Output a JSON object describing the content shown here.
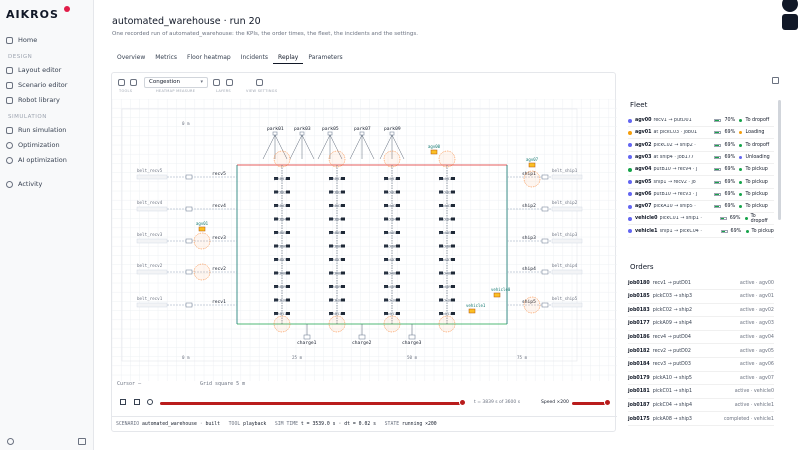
{
  "app": {
    "logo": "AIKROS"
  },
  "sidebar": {
    "items": [
      {
        "label": "Home",
        "icon": "home-icon"
      },
      {
        "section": "DESIGN"
      },
      {
        "label": "Layout editor",
        "icon": "layout-icon"
      },
      {
        "label": "Scenario editor",
        "icon": "scenario-icon"
      },
      {
        "label": "Robot library",
        "icon": "robot-icon"
      },
      {
        "section": "SIMULATION"
      },
      {
        "label": "Run simulation",
        "icon": "play-icon"
      },
      {
        "label": "Optimization",
        "icon": "optimization-icon"
      },
      {
        "label": "AI optimization",
        "icon": "ai-icon"
      },
      {
        "label": "Activity",
        "icon": "activity-icon"
      }
    ]
  },
  "header": {
    "title": "automated_warehouse · run 20",
    "subtitle": "One recorded run of automated_warehouse: the KPIs, the order times, the fleet, the incidents and the settings."
  },
  "tabs": [
    "Overview",
    "Metrics",
    "Floor heatmap",
    "Incidents",
    "Replay",
    "Parameters"
  ],
  "active_tab": "Replay",
  "toolbar": {
    "select_value": "Congestion",
    "labels": [
      "TOOLS",
      "HEATMAP MEASURE",
      "LAYERS",
      "VIEW SETTINGS"
    ]
  },
  "canvas": {
    "scale_top": "0 m",
    "axis": [
      "0 m",
      "25 m",
      "50 m",
      "75 m"
    ],
    "left_parks": [
      "belt_recv5",
      "belt_recv4",
      "belt_recv3",
      "belt_recv2",
      "belt_recv1"
    ],
    "left_recv": [
      "recv5",
      "recv4",
      "recv3",
      "recv2",
      "recv1"
    ],
    "right_parks": [
      "belt_ship1",
      "belt_ship2",
      "belt_ship3",
      "belt_ship4",
      "belt_ship5"
    ],
    "right_ship": [
      "ship1",
      "ship2",
      "ship3",
      "ship4",
      "ship5"
    ],
    "top_parks": [
      "park01",
      "park03",
      "park05",
      "park07",
      "park09"
    ],
    "put_cols": [
      "putB",
      "putD",
      "pick"
    ],
    "charge": [
      "charge1",
      "charge2",
      "charge3"
    ],
    "agents": [
      "agv00",
      "agv01",
      "vehicle0",
      "vehicle1",
      "agv07"
    ]
  },
  "cursor": {
    "label": "Cursor",
    "value": "–"
  },
  "grid": {
    "label": "Grid square",
    "value": "5 m"
  },
  "playback": {
    "time_text": "t = 3839 s of 3600 s",
    "progress": 0.99,
    "speed_label": "Speed ×200",
    "speed_frac": 1.0
  },
  "status": {
    "scenario_key": "SCENARIO",
    "scenario": "automated_warehouse",
    "scenario_state": "built",
    "tool_key": "TOOL",
    "tool": "playback",
    "sim_key": "SIM TIME",
    "sim": "t = 3539.0 s · dt = 0.02 s",
    "state_key": "STATE",
    "state": "running ×200"
  },
  "fleet": {
    "title": "Fleet",
    "rows": [
      {
        "id": "agv00",
        "route": "recv1 → putD01",
        "pct": "70%",
        "status": "To dropoff",
        "color": "#6366f1",
        "scolor": "#16a34a"
      },
      {
        "id": "agv01",
        "route": "at pickC03 · job01",
        "pct": "69%",
        "status": "Loading",
        "color": "#f59e0b",
        "scolor": "#f59e0b"
      },
      {
        "id": "agv02",
        "route": "pickC02 → ship2 · ",
        "pct": "69%",
        "status": "To dropoff",
        "color": "#6366f1",
        "scolor": "#16a34a"
      },
      {
        "id": "agv03",
        "route": "at ship4 · job177",
        "pct": "69%",
        "status": "Unloading",
        "color": "#6366f1",
        "scolor": "#6366f1"
      },
      {
        "id": "agv04",
        "route": "putB10 → recv4 · j",
        "pct": "69%",
        "status": "To pickup",
        "color": "#16a34a",
        "scolor": "#16a34a"
      },
      {
        "id": "agv05",
        "route": "ship1 → recv2 · jo",
        "pct": "69%",
        "status": "To pickup",
        "color": "#6366f1",
        "scolor": "#16a34a"
      },
      {
        "id": "agv06",
        "route": "putB10 → recv3 · j",
        "pct": "69%",
        "status": "To pickup",
        "color": "#6366f1",
        "scolor": "#16a34a"
      },
      {
        "id": "agv07",
        "route": "pickA10 → ship5 · ",
        "pct": "69%",
        "status": "To pickup",
        "color": "#6366f1",
        "scolor": "#16a34a"
      },
      {
        "id": "vehicle0",
        "route": "pickC01 → ship1 ·",
        "pct": "69%",
        "status": "To dropoff",
        "color": "#6366f1",
        "scolor": "#16a34a"
      },
      {
        "id": "vehicle1",
        "route": "ship1 → pickC04 ·",
        "pct": "69%",
        "status": "To pickup",
        "color": "#6366f1",
        "scolor": "#16a34a"
      }
    ]
  },
  "orders": {
    "title": "Orders",
    "rows": [
      {
        "id": "job0180",
        "route": "recv1 → putD01",
        "status": "active · agv00"
      },
      {
        "id": "job0185",
        "route": "pickC03 → ship3",
        "status": "active · agv01"
      },
      {
        "id": "job0183",
        "route": "pickC02 → ship2",
        "status": "active · agv02"
      },
      {
        "id": "job0177",
        "route": "pickA09 → ship4",
        "status": "active · agv03"
      },
      {
        "id": "job0186",
        "route": "recv4 → putD04",
        "status": "active · agv04"
      },
      {
        "id": "job0182",
        "route": "recv2 → putD02",
        "status": "active · agv05"
      },
      {
        "id": "job0184",
        "route": "recv3 → putD03",
        "status": "active · agv06"
      },
      {
        "id": "job0179",
        "route": "pickA10 → ship5",
        "status": "active · agv07"
      },
      {
        "id": "job0181",
        "route": "pickC01 → ship1",
        "status": "active · vehicle0"
      },
      {
        "id": "job0187",
        "route": "pickC04 → ship4",
        "status": "active · vehicle1"
      },
      {
        "id": "job0175",
        "route": "pickA08 → ship3",
        "status": "completed · vehicle1"
      }
    ]
  }
}
